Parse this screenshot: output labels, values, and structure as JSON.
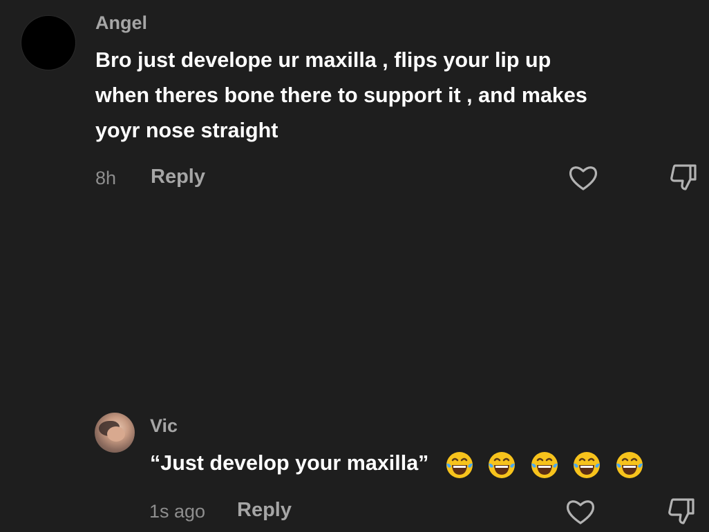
{
  "comments": [
    {
      "username": "Angel",
      "text_lines": [
        "Bro just develope ur maxilla , flips your lip up",
        "when theres bone there to support it , and makes",
        "yoyr nose straight"
      ],
      "time": "8h",
      "reply_label": "Reply",
      "avatar": "black-circle-avatar",
      "icons": {
        "like": "heart-icon",
        "dislike": "thumbs-down-icon"
      }
    },
    {
      "username": "Vic",
      "text": "“Just develop your maxilla”",
      "emojis": [
        "laughing-tears-emoji",
        "laughing-tears-emoji",
        "laughing-tears-emoji",
        "laughing-tears-emoji",
        "laughing-tears-emoji"
      ],
      "time": "1s ago",
      "reply_label": "Reply",
      "avatar": "photo-avatar",
      "icons": {
        "like": "heart-icon",
        "dislike": "thumbs-down-icon"
      }
    }
  ],
  "colors": {
    "background": "#1e1e1e",
    "text_primary": "#ffffff",
    "text_secondary": "#a6a6a6",
    "meta": "#8e8e8e",
    "icon": "#b3b3b3",
    "emoji_face": "#f7c31c"
  }
}
